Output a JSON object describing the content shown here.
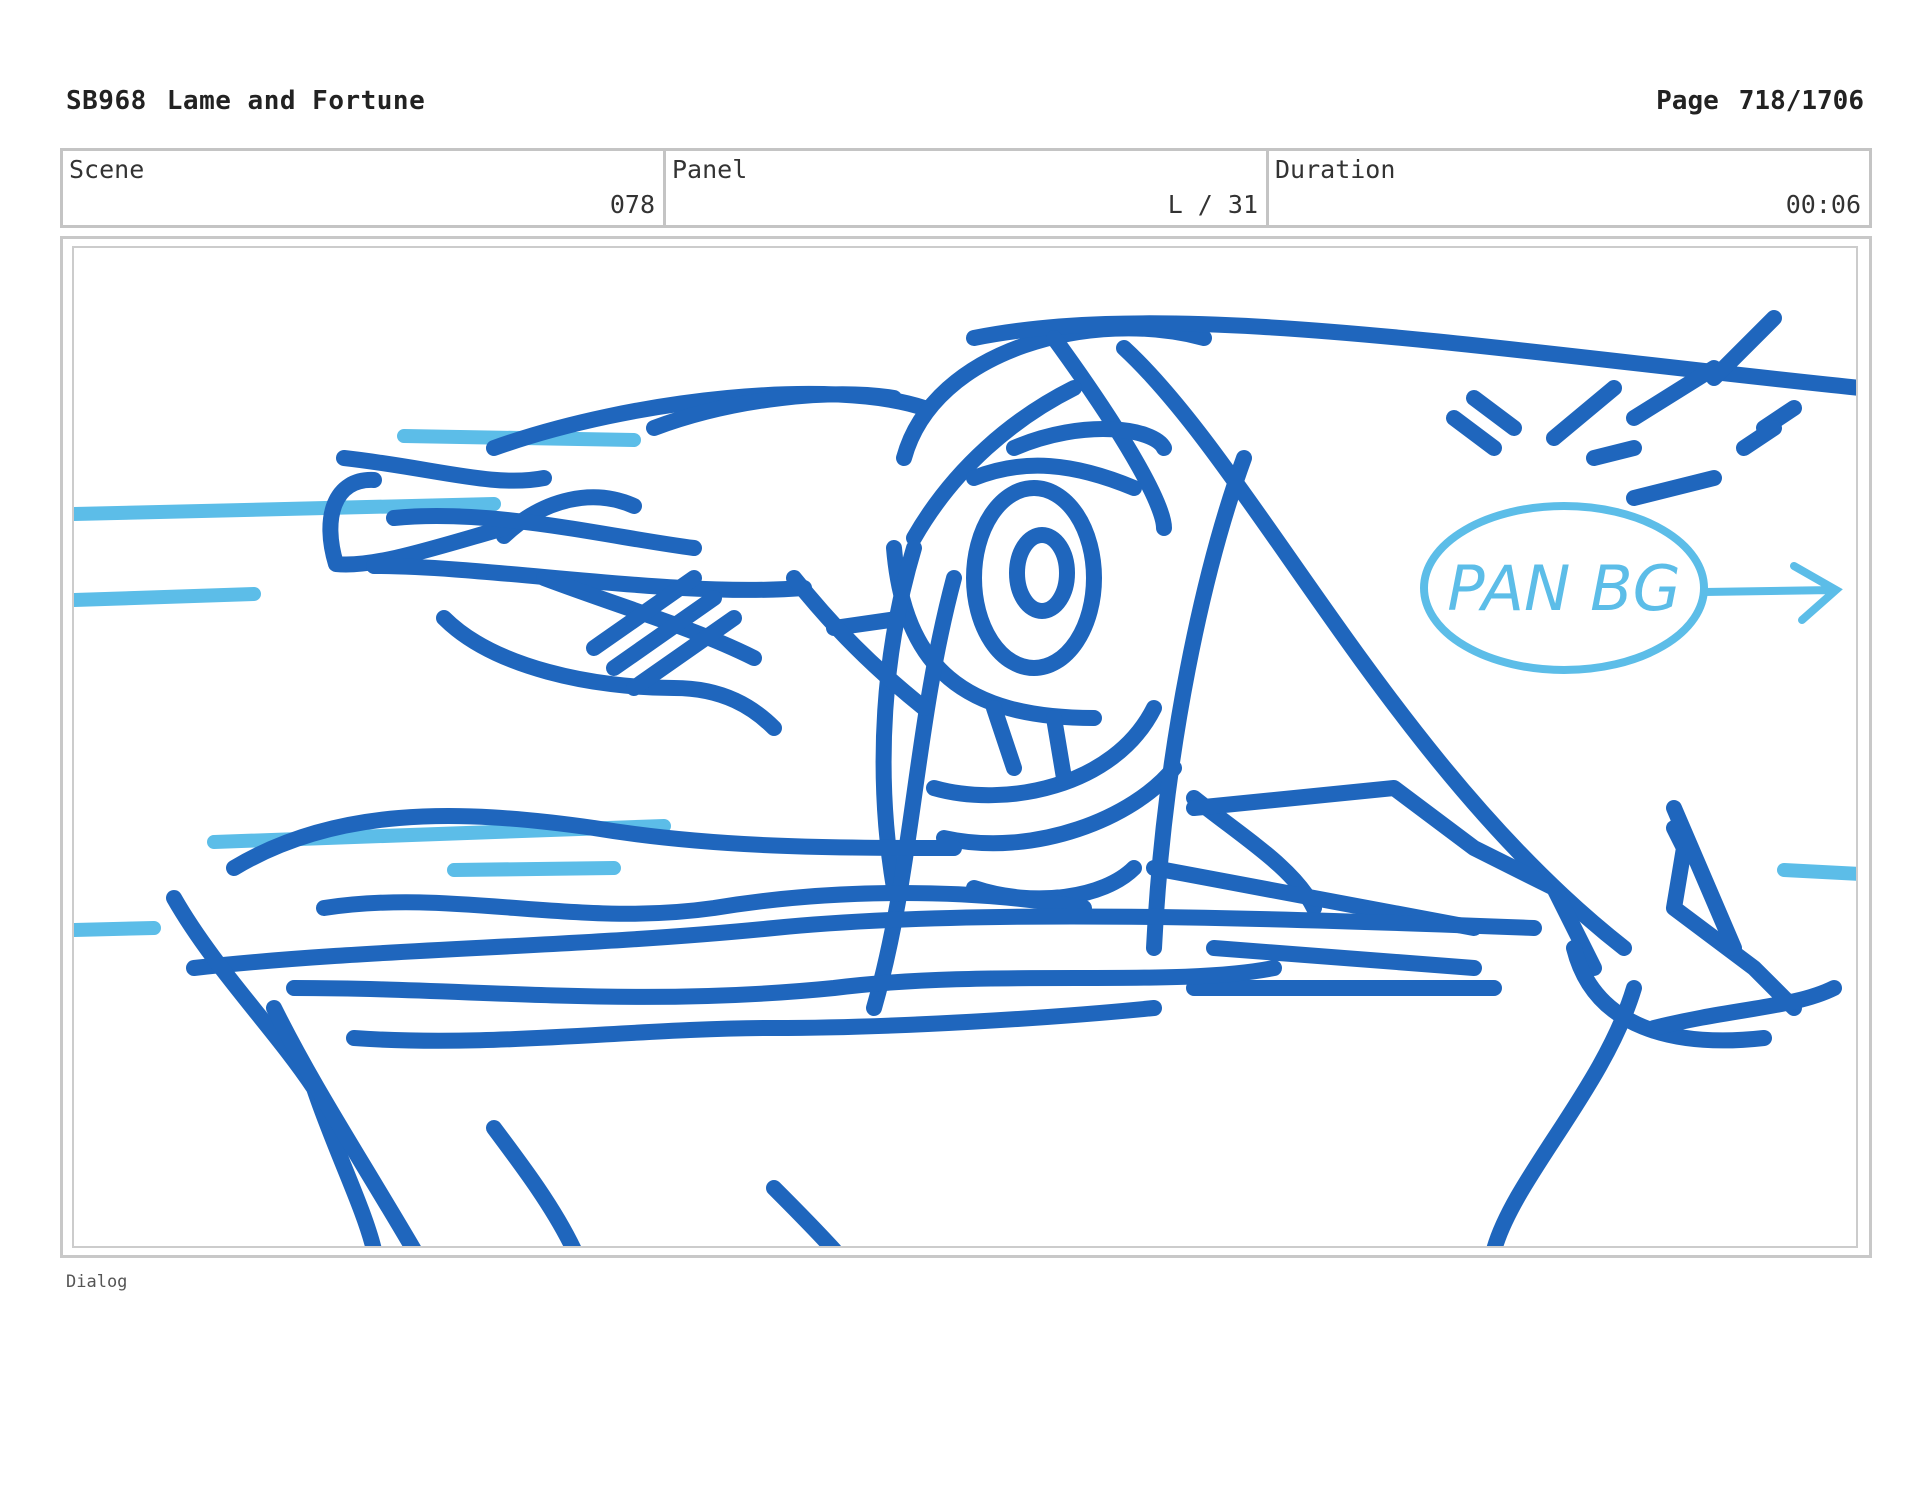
{
  "header": {
    "board_id": "SB968",
    "episode_title": "Lame and Fortune",
    "page_label": "Page",
    "page_number": "718/1706"
  },
  "info": {
    "scene_label": "Scene",
    "scene_value": "078",
    "panel_label": "Panel",
    "panel_value": "L / 31",
    "duration_label": "Duration",
    "duration_value": "00:06"
  },
  "sketch": {
    "note_text": "PAN BG",
    "dark_stroke_color": "#1f66bd",
    "light_stroke_color": "#5cbde8"
  },
  "footer": {
    "dialog_label": "Dialog"
  }
}
